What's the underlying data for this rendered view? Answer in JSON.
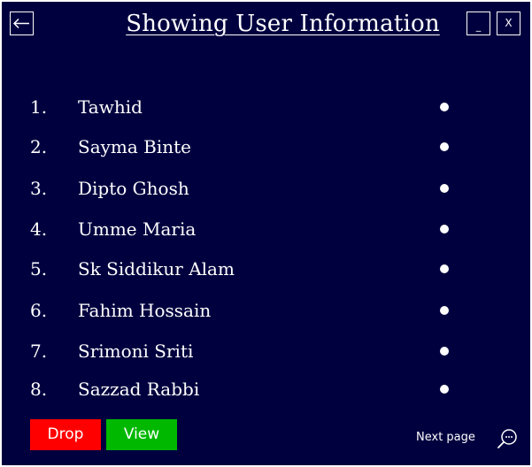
{
  "header": {
    "title": "Showing User Information",
    "minimize_label": "_",
    "close_label": "X"
  },
  "users": [
    {
      "index": "1.",
      "name": "Tawhid"
    },
    {
      "index": "2.",
      "name": "Sayma Binte"
    },
    {
      "index": "3.",
      "name": "Dipto Ghosh"
    },
    {
      "index": "4.",
      "name": "Umme Maria"
    },
    {
      "index": "5.",
      "name": "Sk Siddikur Alam"
    },
    {
      "index": "6.",
      "name": "Fahim Hossain"
    },
    {
      "index": "7.",
      "name": "Srimoni Sriti"
    },
    {
      "index": "8.",
      "name": "Sazzad Rabbi"
    }
  ],
  "actions": {
    "drop_label": "Drop",
    "view_label": "View",
    "next_page_label": "Next page"
  },
  "icons": {
    "back": "back-arrow-icon",
    "search": "search-chat-icon"
  },
  "colors": {
    "background": "#00003f",
    "drop": "#ff0000",
    "view": "#00b800",
    "text": "#ffffff"
  }
}
